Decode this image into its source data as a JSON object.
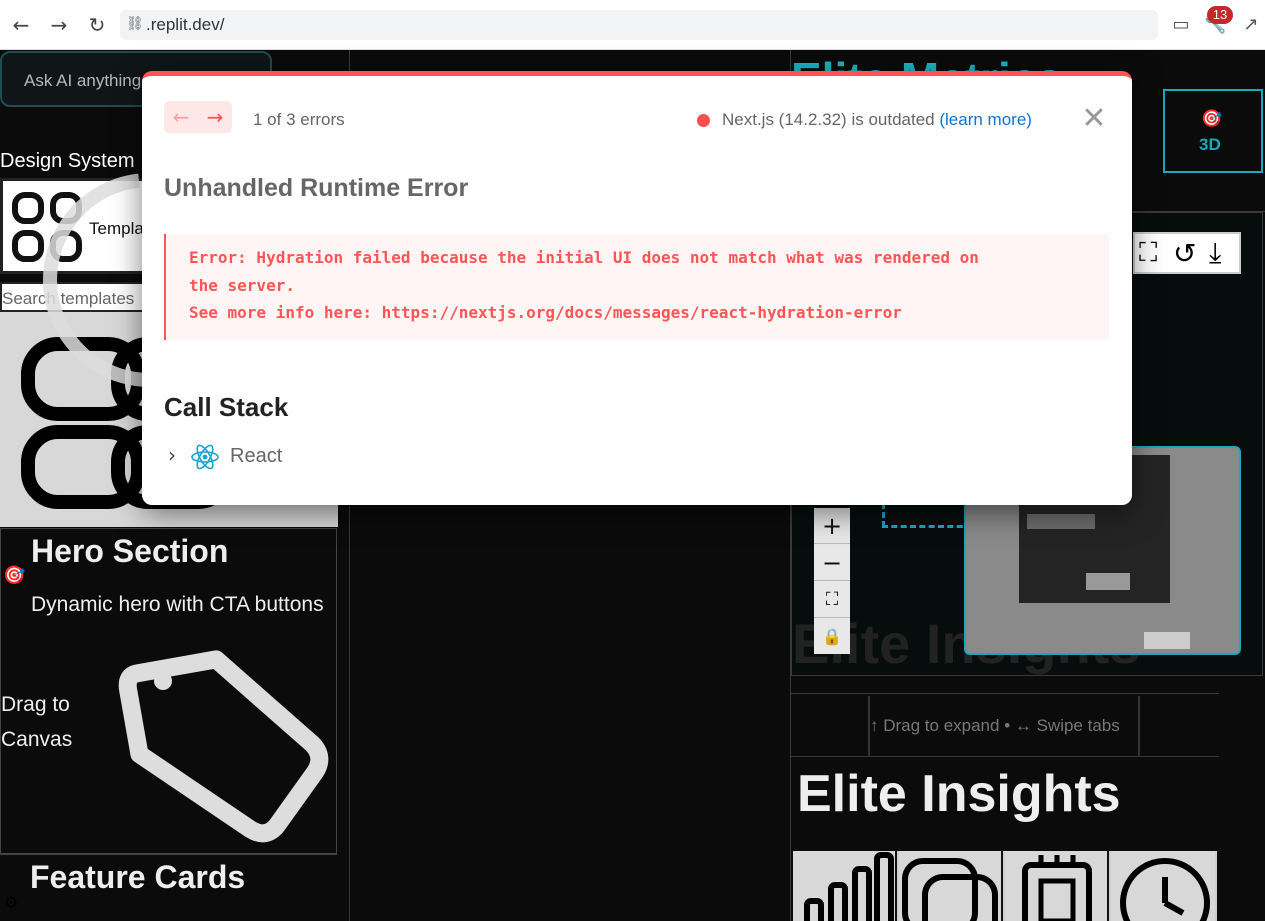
{
  "browser": {
    "url": ".replit.dev/",
    "notification_count": "13"
  },
  "left_panel": {
    "ask_ai_placeholder": "Ask AI anything",
    "design_system_label": "Design System",
    "templates_label": "Templa",
    "search_templates": "Search templates",
    "hero": {
      "title": "Hero Section",
      "description": "Dynamic hero with CTA buttons",
      "drag_hint": "Drag to Canvas"
    },
    "feature_cards_title": "Feature Cards"
  },
  "right_panel": {
    "header_ghost_title": "Elite Metrics",
    "btn_3d_label": "3D",
    "ghost_insights": "Elite Insights",
    "expand_hint": "↑ Drag to expand • ↔ Swipe tabs",
    "insights_title": "Elite Insights"
  },
  "error_overlay": {
    "error_counter": "1 of 3 errors",
    "version_notice": "Next.js (14.2.32) is outdated",
    "learn_more": "(learn more)",
    "title": "Unhandled Runtime Error",
    "message_line1": "Error: Hydration failed because the initial UI does not match what was rendered on",
    "message_line2": "the server.",
    "message_line3": "See more info here: https://nextjs.org/docs/messages/react-hydration-error",
    "call_stack_title": "Call Stack",
    "stack_frame_label": "React"
  },
  "colors": {
    "accent_teal": "#19a9bf",
    "error_red": "#ff5555",
    "link_blue": "#0f73d6"
  }
}
